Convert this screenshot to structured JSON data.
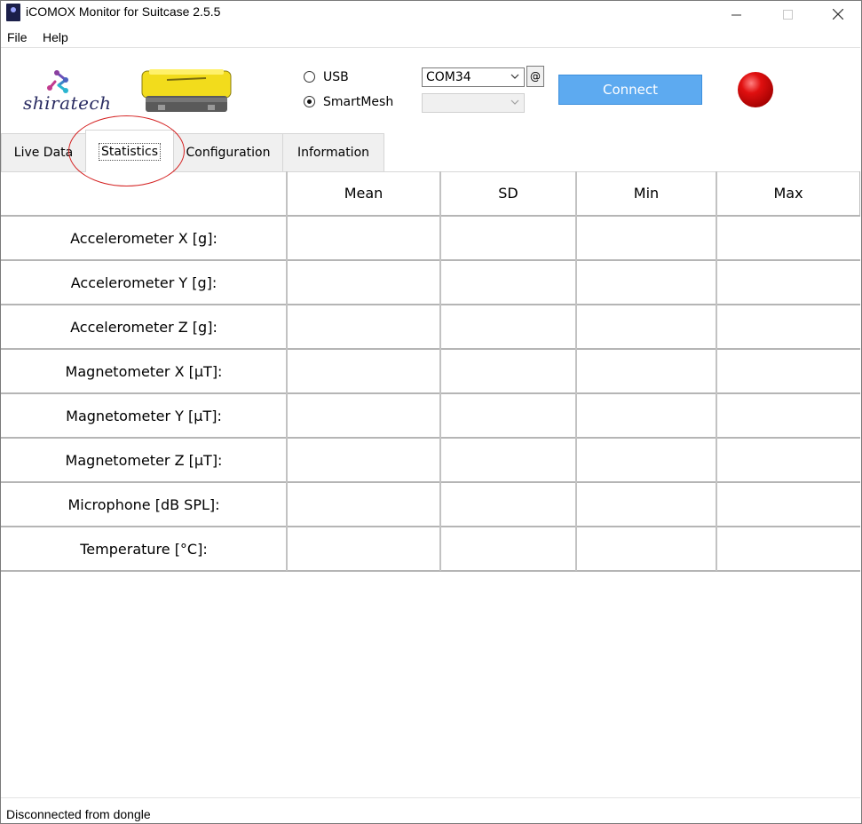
{
  "window": {
    "title": "iCOMOX Monitor for Suitcase 2.5.5"
  },
  "menu": {
    "file": "File",
    "help": "Help"
  },
  "logo": {
    "text": "shiratech"
  },
  "connection": {
    "radio_usb": "USB",
    "radio_smartmesh": "SmartMesh",
    "selected": "SmartMesh",
    "port_value": "COM34",
    "mesh_value": "",
    "at_button": "@",
    "connect_label": "Connect",
    "led_color": "#e01010"
  },
  "tabs": [
    {
      "label": "Live Data",
      "active": false
    },
    {
      "label": "Statistics",
      "active": true
    },
    {
      "label": "Configuration",
      "active": false
    },
    {
      "label": "Information",
      "active": false
    }
  ],
  "statistics": {
    "columns": [
      "Mean",
      "SD",
      "Min",
      "Max"
    ],
    "rows": [
      "Accelerometer X [g]:",
      "Accelerometer Y [g]:",
      "Accelerometer Z [g]:",
      "Magnetometer X [μT]:",
      "Magnetometer Y [μT]:",
      "Magnetometer Z [μT]:",
      "Microphone [dB SPL]:",
      "Temperature [°C]:"
    ]
  },
  "status_bar": {
    "text": "Disconnected from dongle"
  },
  "colors": {
    "connect_button": "#5daaf0",
    "annotation_circle": "#d42020",
    "logo_text": "#2a2c62"
  }
}
